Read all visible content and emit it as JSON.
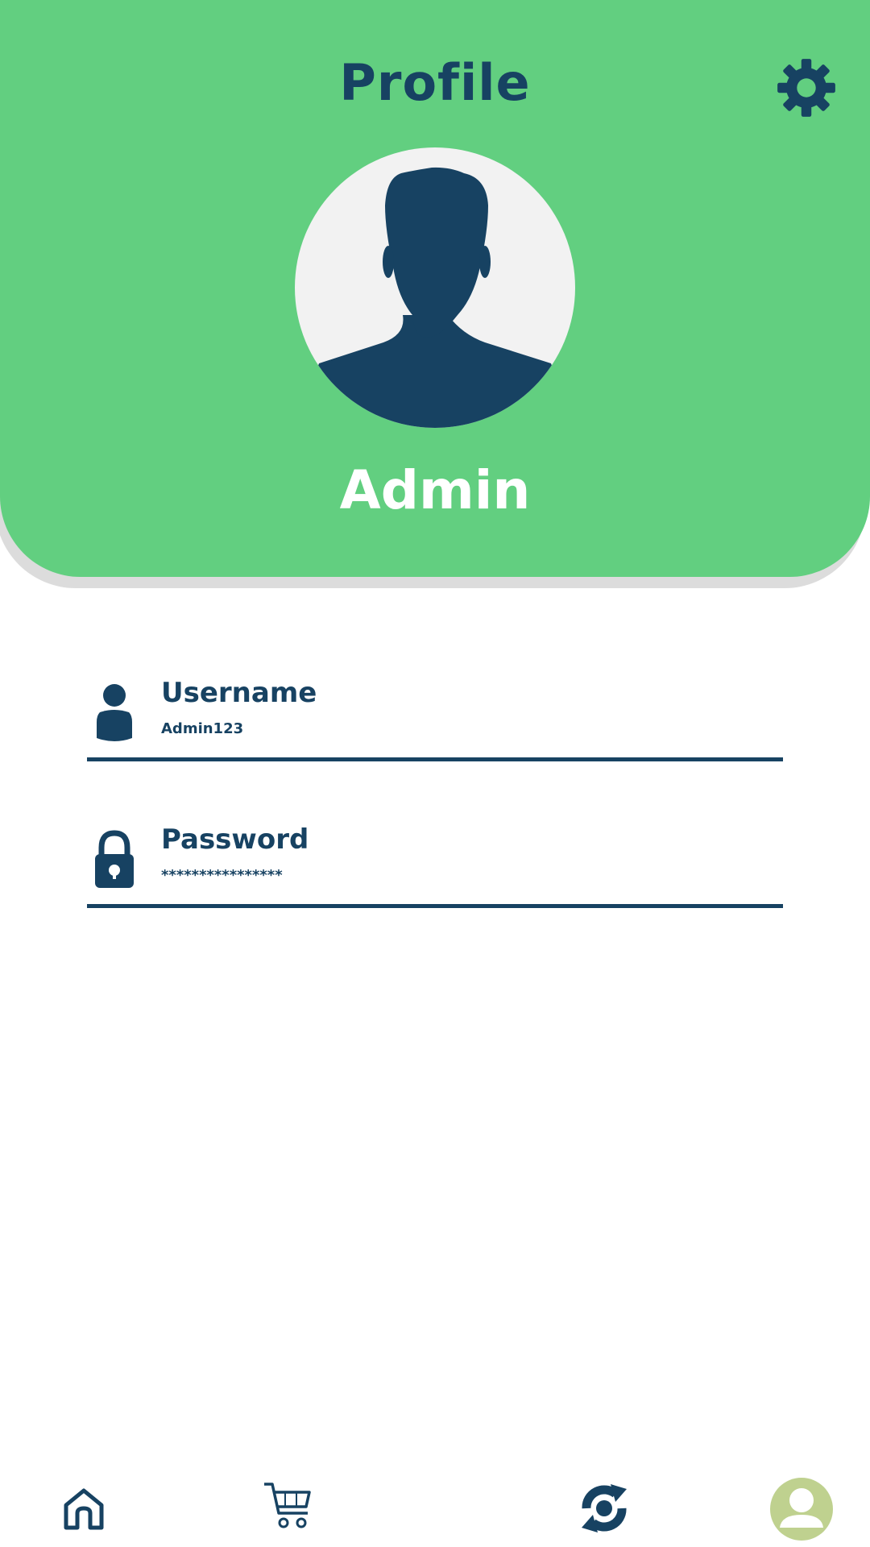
{
  "header": {
    "title": "Profile",
    "settings_icon": "gear-icon",
    "avatar_icon": "user-silhouette-icon",
    "user_display_name": "Admin"
  },
  "fields": {
    "username": {
      "label": "Username",
      "value": "Admin123",
      "icon": "person-icon"
    },
    "password": {
      "label": "Password",
      "value": "****************",
      "icon": "lock-icon"
    }
  },
  "bottom_nav": {
    "items": [
      {
        "icon": "home-icon"
      },
      {
        "icon": "cart-icon"
      },
      {
        "icon": "refresh-icon"
      },
      {
        "icon": "profile-icon",
        "active": true
      }
    ]
  },
  "colors": {
    "header_bg": "#62cf80",
    "primary_dark": "#174262",
    "avatar_bg": "#f2f2f2",
    "active_nav_bg": "#bfd18f"
  }
}
